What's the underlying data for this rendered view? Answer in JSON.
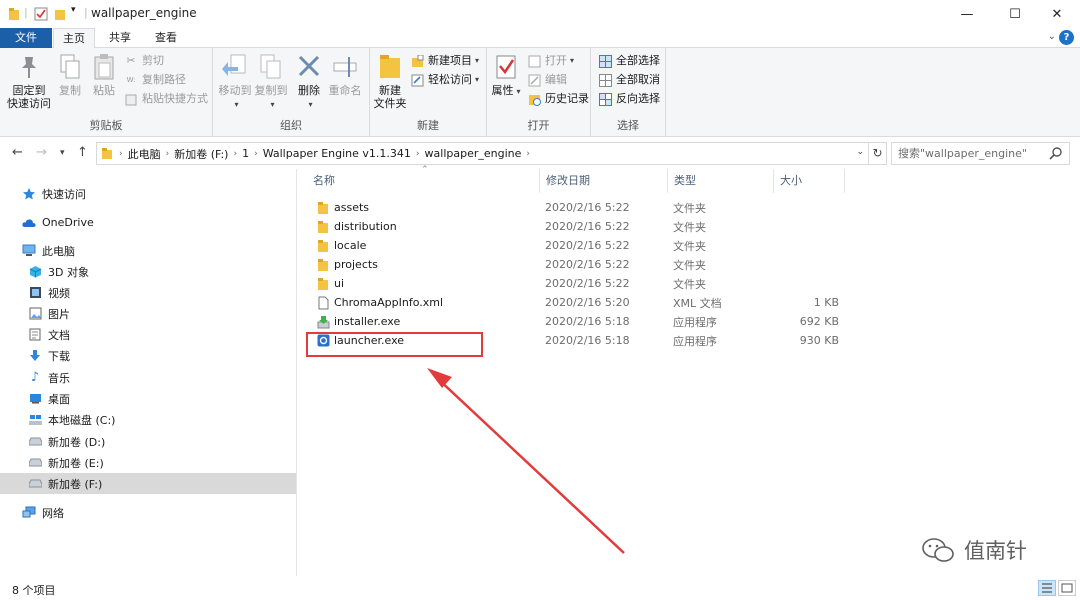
{
  "window": {
    "title": "wallpaper_engine",
    "minimize": "—",
    "maximize": "☐",
    "close": "✕"
  },
  "tabs": {
    "file": "文件",
    "home": "主页",
    "share": "共享",
    "view": "查看"
  },
  "ribbon": {
    "clipboard": {
      "label": "剪贴板",
      "pin": "固定到\n快速访问",
      "pin_line1": "固定到",
      "pin_line2": "快速访问",
      "copy": "复制",
      "paste": "粘贴",
      "cut": "剪切",
      "copy_path": "复制路径",
      "paste_shortcut": "粘贴快捷方式"
    },
    "organize": {
      "label": "组织",
      "move_to": "移动到",
      "copy_to": "复制到",
      "delete": "删除",
      "rename": "重命名"
    },
    "new": {
      "label": "新建",
      "new_folder_line1": "新建",
      "new_folder_line2": "文件夹",
      "new_item": "新建项目",
      "easy_access": "轻松访问"
    },
    "open": {
      "label": "打开",
      "properties": "属性",
      "open": "打开",
      "edit": "编辑",
      "history": "历史记录"
    },
    "select": {
      "label": "选择",
      "select_all": "全部选择",
      "select_none": "全部取消",
      "invert": "反向选择"
    }
  },
  "address": {
    "crumbs": [
      "此电脑",
      "新加卷 (F:)",
      "1",
      "Wallpaper Engine v1.1.341",
      "wallpaper_engine"
    ],
    "search_placeholder": "搜索\"wallpaper_engine\""
  },
  "sidebar": {
    "items": [
      {
        "label": "快速访问",
        "icon": "star-icon"
      },
      {
        "label": "OneDrive",
        "icon": "cloud-icon"
      },
      {
        "label": "此电脑",
        "icon": "computer-icon"
      },
      {
        "label": "3D 对象",
        "icon": "cube-icon"
      },
      {
        "label": "视频",
        "icon": "video-icon"
      },
      {
        "label": "图片",
        "icon": "picture-icon"
      },
      {
        "label": "文档",
        "icon": "document-icon"
      },
      {
        "label": "下载",
        "icon": "download-icon"
      },
      {
        "label": "音乐",
        "icon": "music-icon"
      },
      {
        "label": "桌面",
        "icon": "desktop-icon"
      },
      {
        "label": "本地磁盘 (C:)",
        "icon": "drive-windows-icon"
      },
      {
        "label": "新加卷 (D:)",
        "icon": "drive-icon"
      },
      {
        "label": "新加卷 (E:)",
        "icon": "drive-icon"
      },
      {
        "label": "新加卷 (F:)",
        "icon": "drive-icon"
      },
      {
        "label": "网络",
        "icon": "network-icon"
      }
    ]
  },
  "columns": {
    "name": "名称",
    "date": "修改日期",
    "type": "类型",
    "size": "大小"
  },
  "files": [
    {
      "name": "assets",
      "date": "2020/2/16 5:22",
      "type": "文件夹",
      "size": "",
      "icon": "folder-icon"
    },
    {
      "name": "distribution",
      "date": "2020/2/16 5:22",
      "type": "文件夹",
      "size": "",
      "icon": "folder-icon"
    },
    {
      "name": "locale",
      "date": "2020/2/16 5:22",
      "type": "文件夹",
      "size": "",
      "icon": "folder-icon"
    },
    {
      "name": "projects",
      "date": "2020/2/16 5:22",
      "type": "文件夹",
      "size": "",
      "icon": "folder-icon"
    },
    {
      "name": "ui",
      "date": "2020/2/16 5:22",
      "type": "文件夹",
      "size": "",
      "icon": "folder-icon"
    },
    {
      "name": "ChromaAppInfo.xml",
      "date": "2020/2/16 5:20",
      "type": "XML 文档",
      "size": "1 KB",
      "icon": "xml-file-icon"
    },
    {
      "name": "installer.exe",
      "date": "2020/2/16 5:18",
      "type": "应用程序",
      "size": "692 KB",
      "icon": "installer-icon"
    },
    {
      "name": "launcher.exe",
      "date": "2020/2/16 5:18",
      "type": "应用程序",
      "size": "930 KB",
      "icon": "launcher-icon"
    }
  ],
  "status": {
    "item_count": "8 个项目"
  },
  "watermark": "值南针",
  "colors": {
    "accent": "#1a5fa8",
    "highlight_red": "#e33b3b",
    "folder": "#f5c342"
  }
}
